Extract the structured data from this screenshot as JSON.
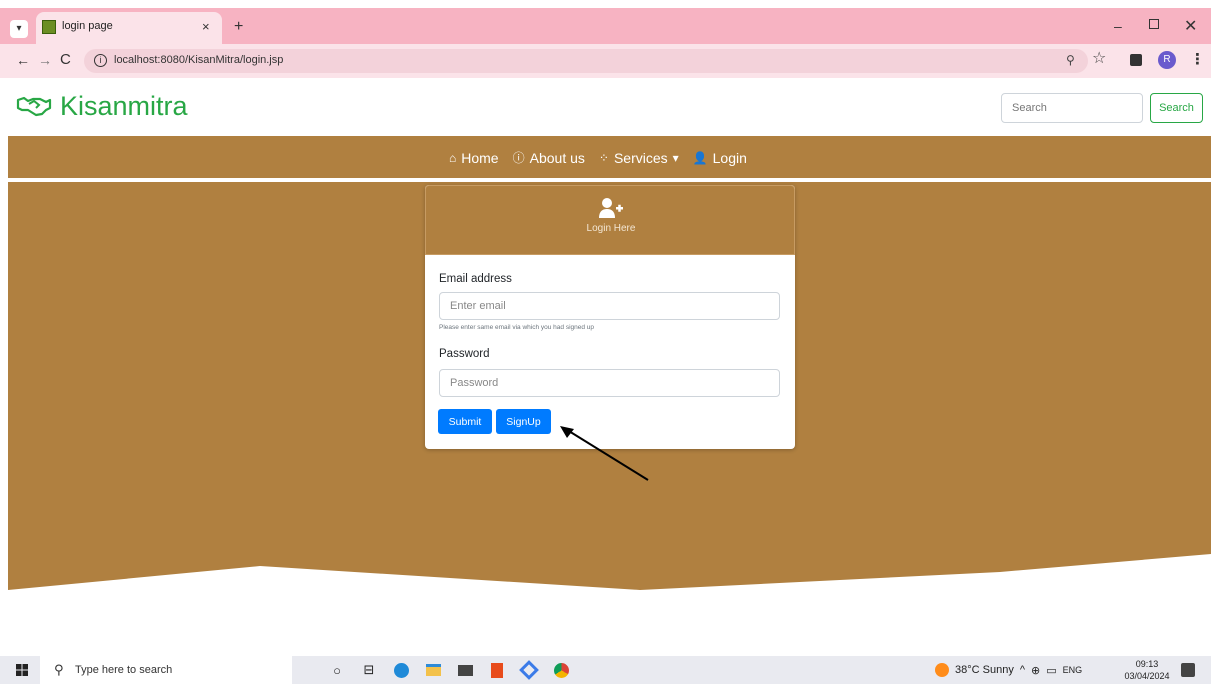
{
  "browser": {
    "tab_title": "login page",
    "tab_close": "×",
    "new_tab": "+",
    "url": "localhost:8080/KisanMitra/login.jsp",
    "profile_initial": "R",
    "controls": {
      "minimize": "–",
      "close": "✕",
      "back": "←",
      "forward": "→",
      "reload": "C"
    }
  },
  "site": {
    "brand": "Kisanmitra",
    "brand_color": "#28a745",
    "search_placeholder": "Search",
    "search_button": "Search",
    "nav": [
      {
        "label": "Home",
        "icon": "home-icon"
      },
      {
        "label": "About us",
        "icon": "info-icon"
      },
      {
        "label": "Services",
        "icon": "spinner-icon",
        "dropdown": true
      },
      {
        "label": "Login",
        "icon": "user-plus-icon"
      }
    ],
    "theme_color": "#b08040"
  },
  "login_card": {
    "header_title": "Login Here",
    "email_label": "Email address",
    "email_placeholder": "Enter email",
    "email_help": "Please enter same email via which you had signed up",
    "password_label": "Password",
    "password_placeholder": "Password",
    "submit_label": "Submit",
    "signup_label": "SignUp",
    "button_color": "#007bff"
  },
  "taskbar": {
    "search_text": "Type here to search",
    "weather": "38°C Sunny",
    "lang": "ENG",
    "time": "09:13",
    "date": "03/04/2024"
  }
}
